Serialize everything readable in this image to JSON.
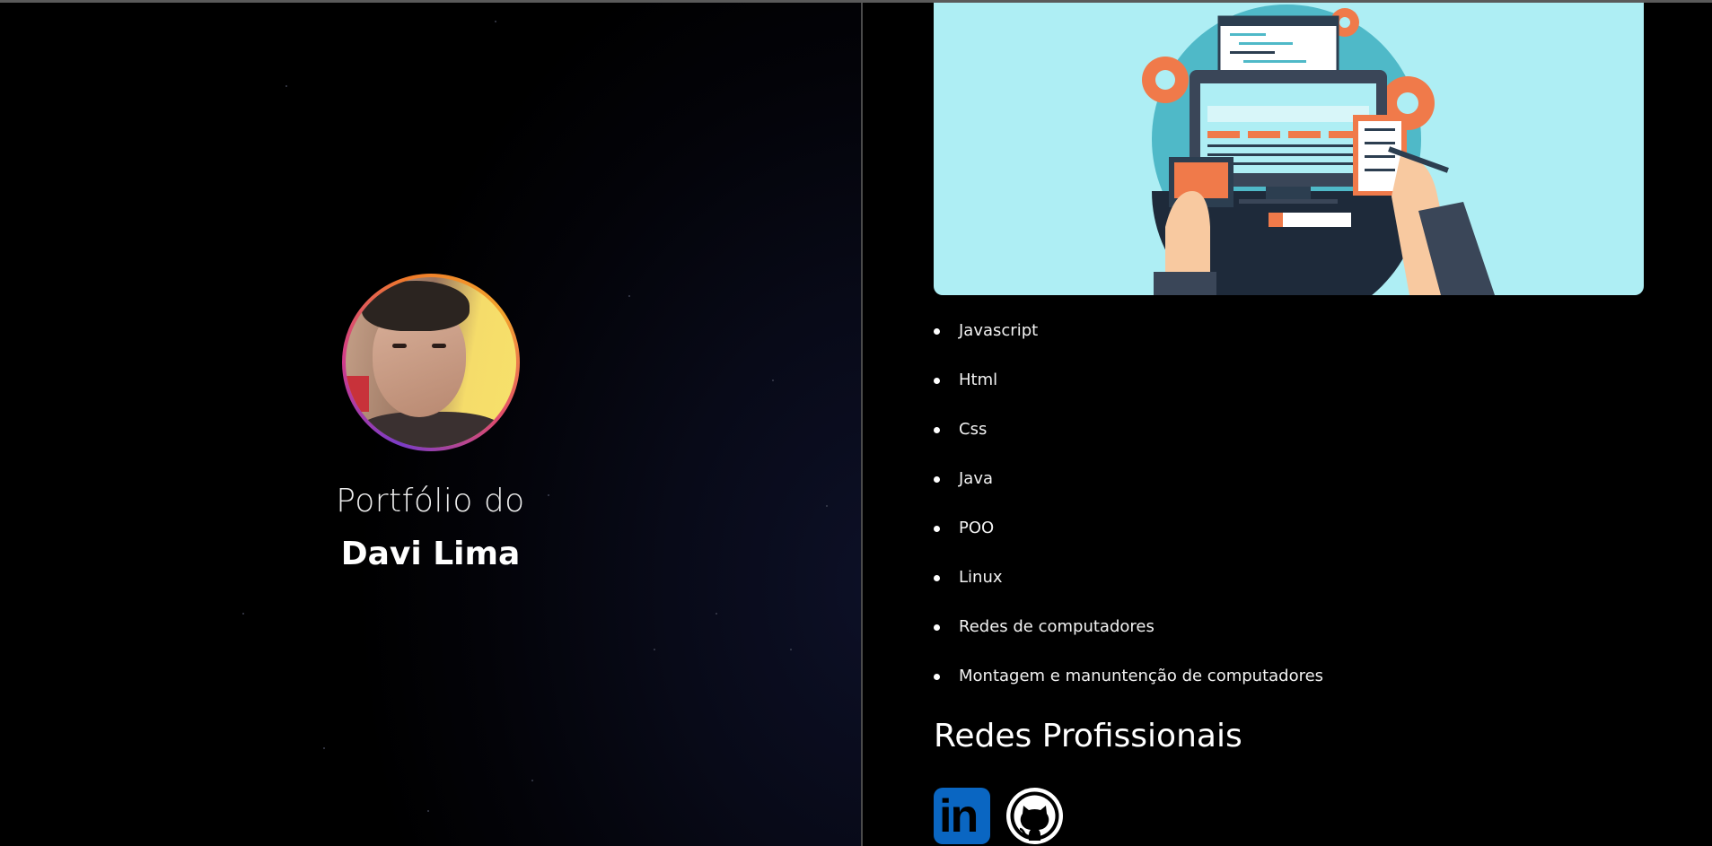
{
  "profile": {
    "title_small": "Portfólio do",
    "title_big": "Davi Lima",
    "avatar_icon": "profile-photo"
  },
  "skills": [
    "Javascript",
    "Html",
    "Css",
    "Java",
    "POO",
    "Linux",
    "Redes de computadores",
    "Montagem e manuntenção de computadores"
  ],
  "social_section": {
    "title": "Redes Profissionais",
    "links": [
      {
        "name": "linkedin",
        "icon": "linkedin-icon",
        "label": "in",
        "color": "#0a66c2"
      },
      {
        "name": "github",
        "icon": "github-icon",
        "color": "#ffffff"
      }
    ]
  },
  "colors": {
    "background": "#000000",
    "hero_background": "#aeeef4",
    "accent_orange": "#f07a4a",
    "avatar_ring_start": "#7a3cc8",
    "avatar_ring_end": "#f07a2a"
  }
}
